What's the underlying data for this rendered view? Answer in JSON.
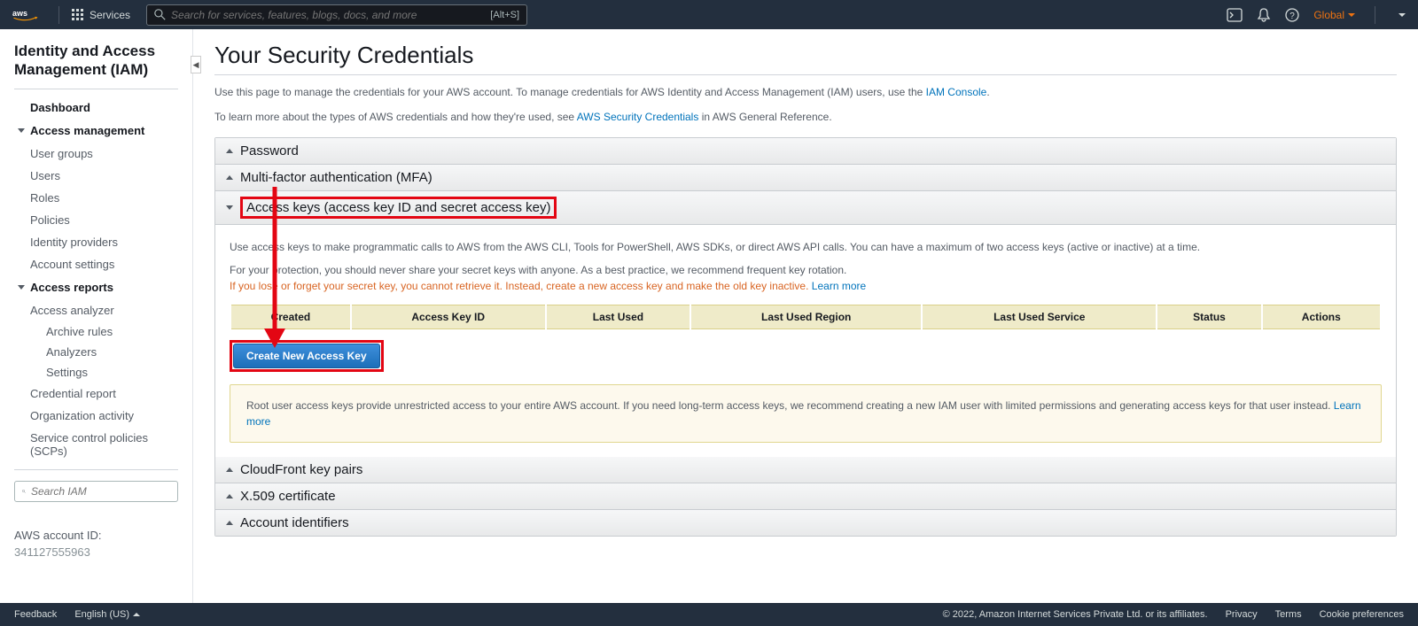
{
  "topnav": {
    "services_label": "Services",
    "search_placeholder": "Search for services, features, blogs, docs, and more",
    "search_shortcut": "[Alt+S]",
    "region": "Global",
    "user": ""
  },
  "sidebar": {
    "title": "Identity and Access Management (IAM)",
    "dashboard": "Dashboard",
    "access_mgmt_label": "Access management",
    "access_mgmt_items": [
      "User groups",
      "Users",
      "Roles",
      "Policies",
      "Identity providers",
      "Account settings"
    ],
    "access_reports_label": "Access reports",
    "access_reports_items": [
      "Access analyzer"
    ],
    "analyzer_sub": [
      "Archive rules",
      "Analyzers",
      "Settings"
    ],
    "report_items": [
      "Credential report",
      "Organization activity",
      "Service control policies (SCPs)"
    ],
    "search_placeholder": "Search IAM",
    "account_label": "AWS account ID:",
    "account_id": "341127555963"
  },
  "content": {
    "page_title": "Your Security Credentials",
    "intro1_pre": "Use this page to manage the credentials for your AWS account. To manage credentials for AWS Identity and Access Management (IAM) users, use the ",
    "intro1_link": "IAM Console",
    "intro1_post": ".",
    "intro2_pre": "To learn more about the types of AWS credentials and how they're used, see ",
    "intro2_link": "AWS Security Credentials",
    "intro2_post": " in AWS General Reference.",
    "sections": {
      "password": "Password",
      "mfa": "Multi-factor authentication (MFA)",
      "access_keys": "Access keys (access key ID and secret access key)",
      "cloudfront": "CloudFront key pairs",
      "x509": "X.509 certificate",
      "account_ids": "Account identifiers"
    },
    "access_keys_body": {
      "p1": "Use access keys to make programmatic calls to AWS from the AWS CLI, Tools for PowerShell, AWS SDKs, or direct AWS API calls. You can have a maximum of two access keys (active or inactive) at a time.",
      "p2": "For your protection, you should never share your secret keys with anyone. As a best practice, we recommend frequent key rotation.",
      "warn": "If you lose or forget your secret key, you cannot retrieve it. Instead, create a new access key and make the old key inactive.",
      "learn_more": "Learn more",
      "table_headers": [
        "Created",
        "Access Key ID",
        "Last Used",
        "Last Used Region",
        "Last Used Service",
        "Status",
        "Actions"
      ],
      "create_btn": "Create New Access Key",
      "info_box_pre": "Root user access keys provide unrestricted access to your entire AWS account. If you need long-term access keys, we recommend creating a new IAM user with limited permissions and generating access keys for that user instead. ",
      "info_box_link": "Learn more"
    }
  },
  "footer": {
    "feedback": "Feedback",
    "language": "English (US)",
    "copyright": "© 2022, Amazon Internet Services Private Ltd. or its affiliates.",
    "links": [
      "Privacy",
      "Terms",
      "Cookie preferences"
    ]
  }
}
